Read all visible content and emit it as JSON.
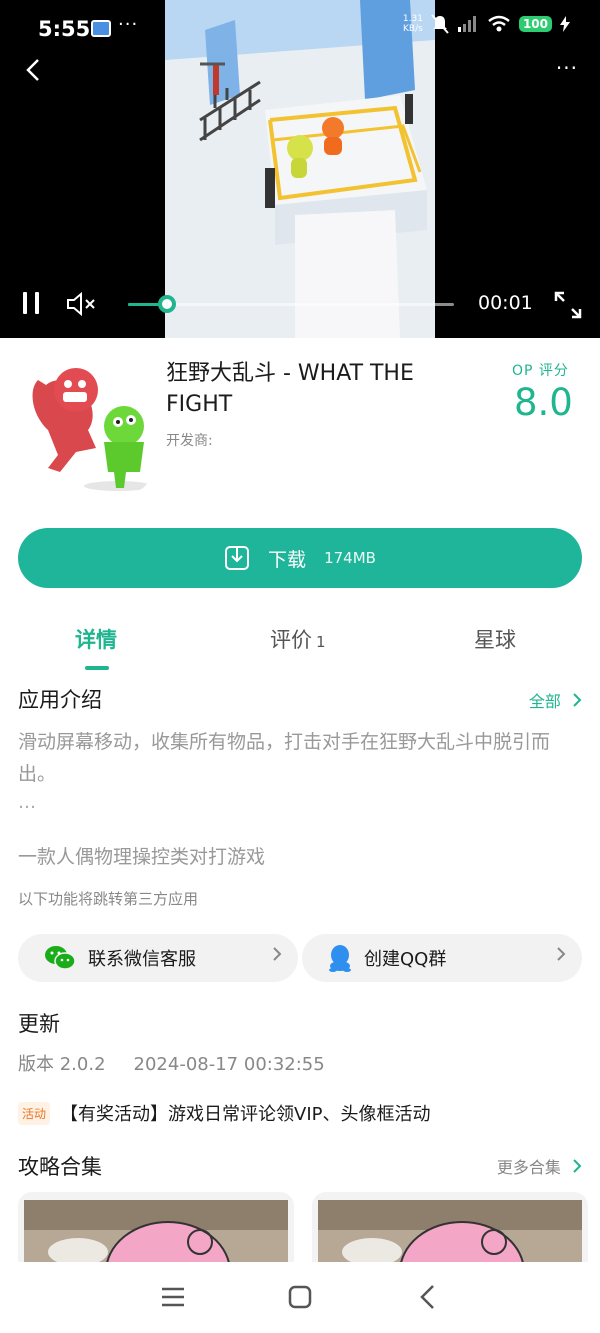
{
  "status_bar": {
    "time": "5:55",
    "more": "···",
    "speed_value": "1.31",
    "speed_unit": "KB/s",
    "battery": "100"
  },
  "video": {
    "elapsed": "00:01",
    "progress_fraction": 0.12,
    "accent": "#1fb58f"
  },
  "app": {
    "name": "狂野大乱斗 - WHAT THE FIGHT",
    "developer": "开发商:",
    "score_label": "OP 评分",
    "score": "8.0"
  },
  "download": {
    "label": "下载",
    "size": "174MB",
    "color": "#1fb59a"
  },
  "tabs": [
    {
      "label": "详情",
      "active": true
    },
    {
      "label": "评价",
      "count": "1"
    },
    {
      "label": "星球"
    }
  ],
  "intro": {
    "title": "应用介绍",
    "all_label": "全部",
    "text": "滑动屏幕移动，收集所有物品，打击对手在狂野大乱斗中脱引而出。",
    "ellipsis": "…",
    "subdesc": "一款人偶物理操控类对打游戏",
    "third_party_note": "以下功能将跳转第三方应用",
    "wechat_label": "联系微信客服",
    "qq_label": "创建QQ群"
  },
  "update": {
    "title": "更新",
    "version": "版本 2.0.2",
    "date": "2024-08-17 00:32:55",
    "event_badge": "活动",
    "event_text": "【有奖活动】游戏日常评论领VIP、头像框活动"
  },
  "guides": {
    "title": "攻略合集",
    "more_label": "更多合集"
  }
}
